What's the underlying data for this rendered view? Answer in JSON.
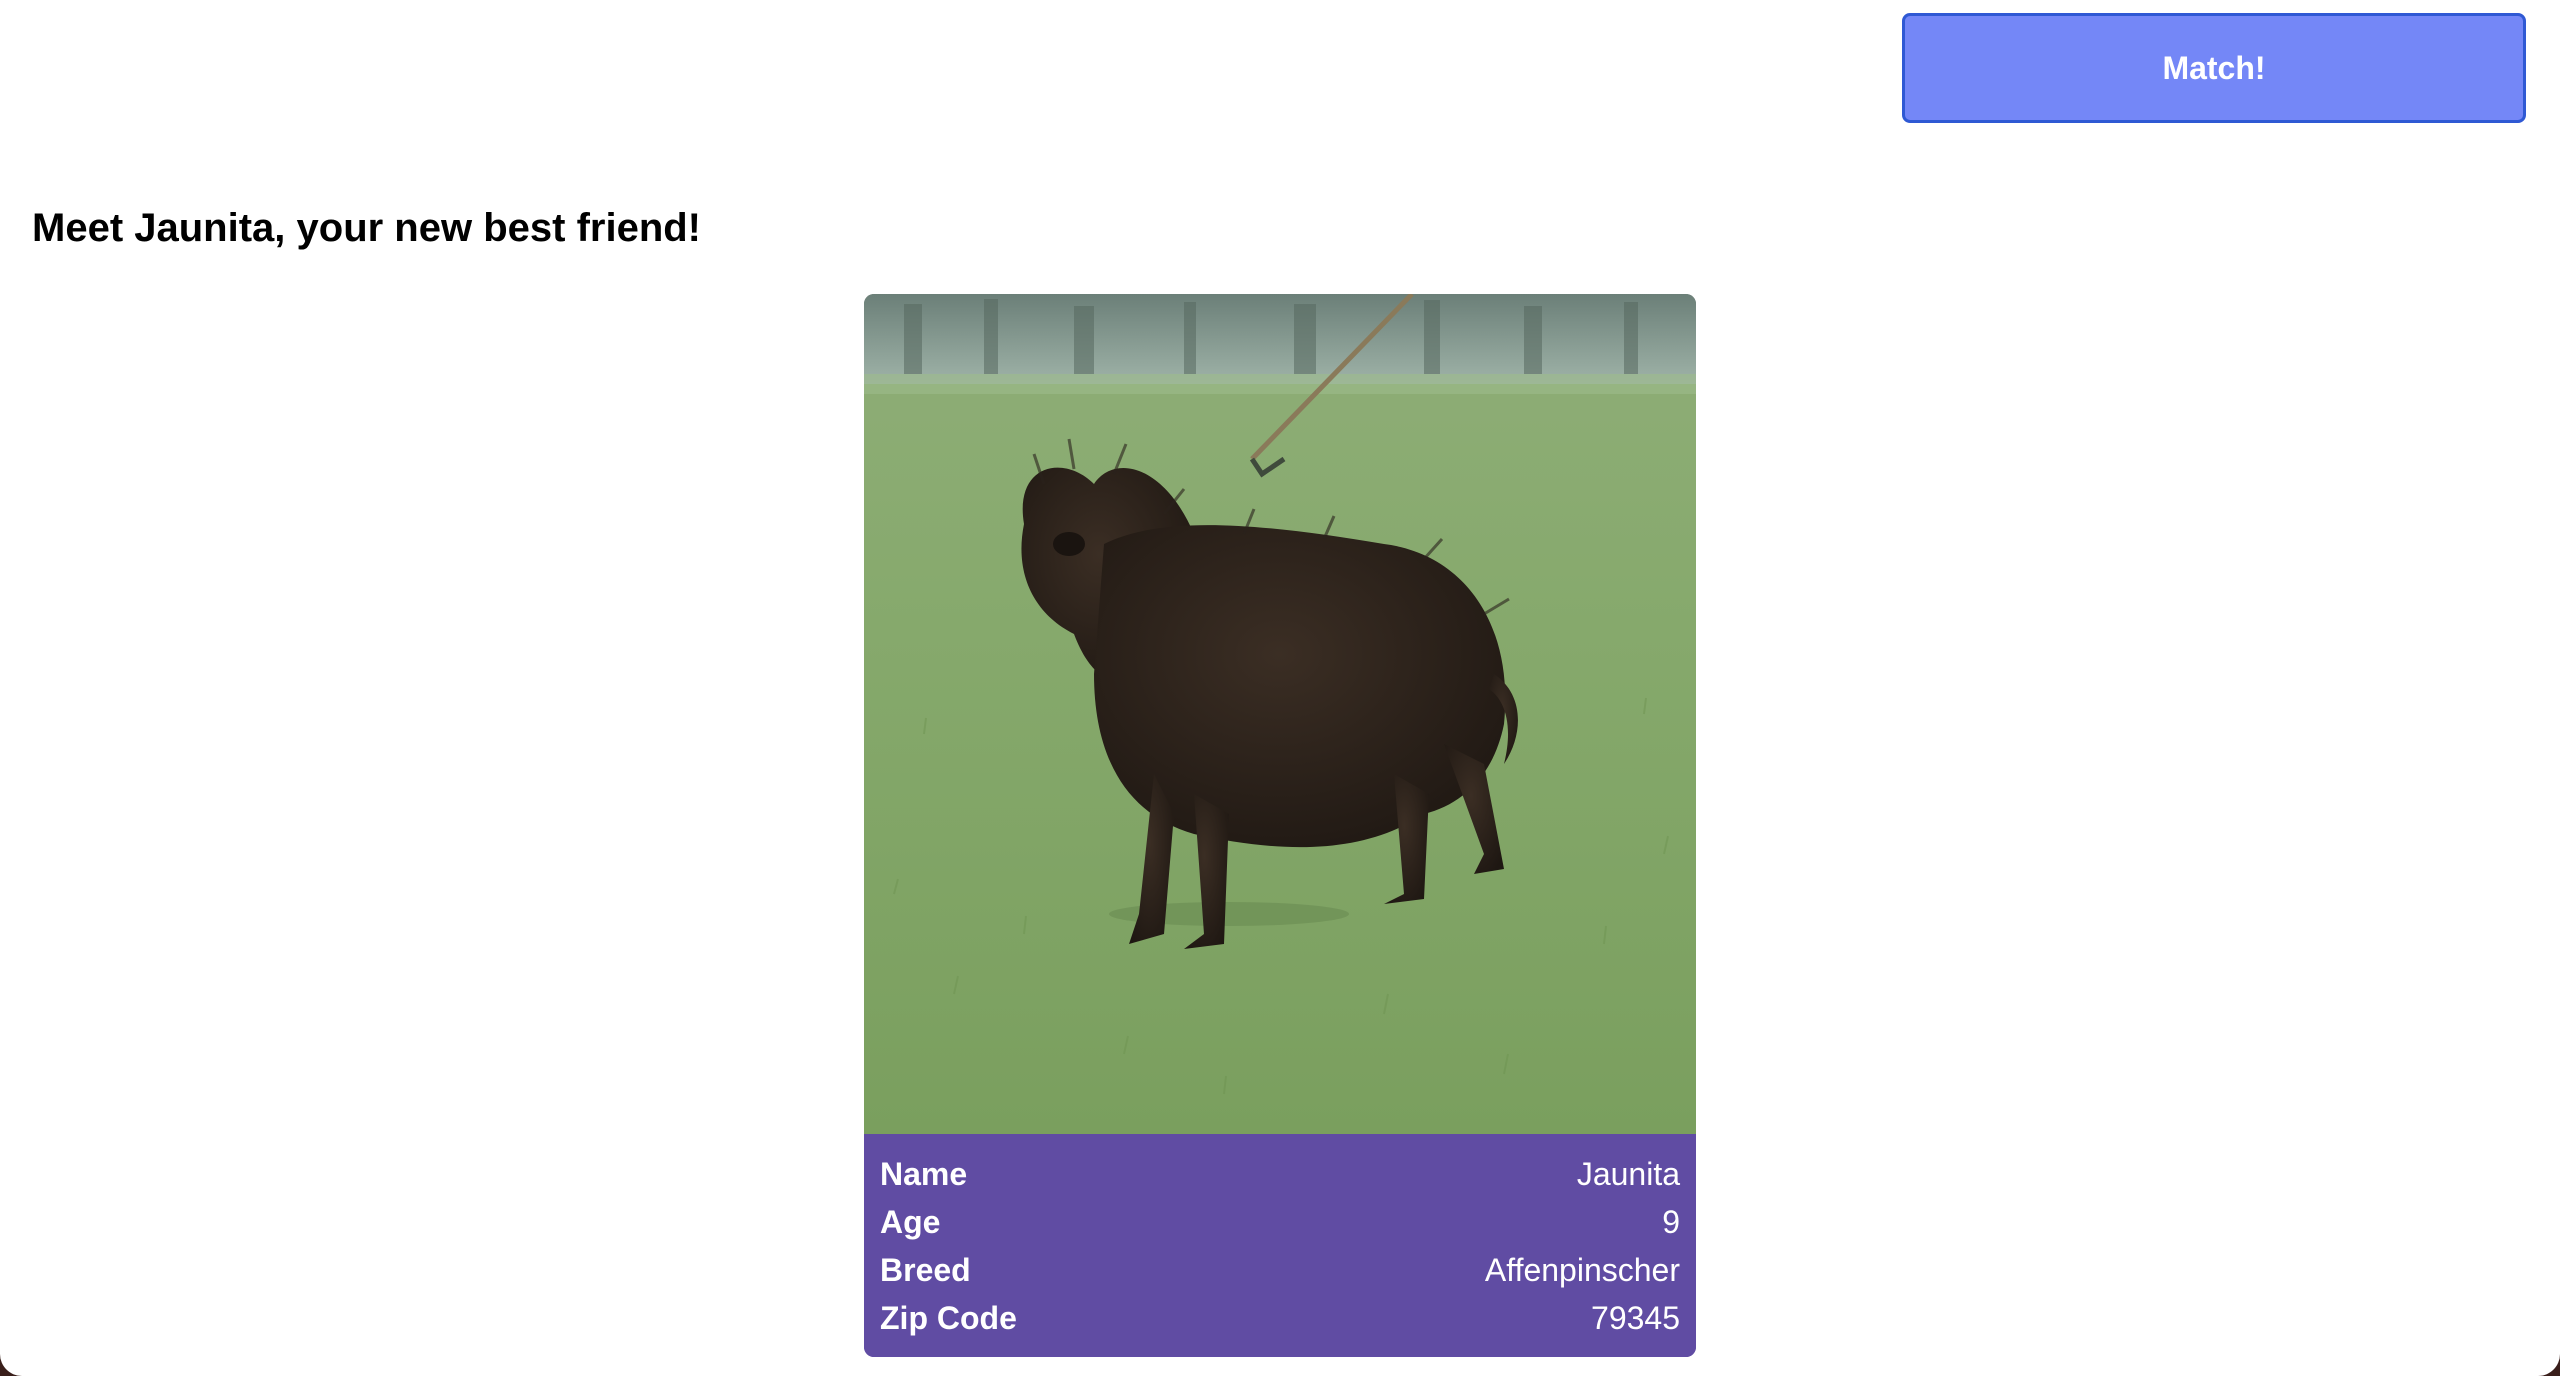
{
  "actions": {
    "match_label": "Match!"
  },
  "heading": "Meet Jaunita, your new best friend!",
  "dog": {
    "photo_subject": "black shaggy terrier on a leash standing on grass",
    "details": [
      {
        "label": "Name",
        "value": "Jaunita"
      },
      {
        "label": "Age",
        "value": "9"
      },
      {
        "label": "Breed",
        "value": "Affenpinscher"
      },
      {
        "label": "Zip Code",
        "value": "79345"
      }
    ]
  },
  "colors": {
    "button_bg": "#7487f7",
    "button_border": "#2f59d4",
    "card_info_bg": "#604ca3"
  }
}
